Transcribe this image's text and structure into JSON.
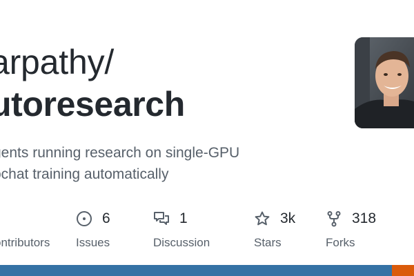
{
  "owner": "arpathy/",
  "repo": "utoresearch",
  "description": [
    "gents running research on single-GPU",
    "ochat training automatically"
  ],
  "stats": {
    "contributors": {
      "value": "",
      "label": "ontributors"
    },
    "issues": {
      "value": "6",
      "label": "Issues",
      "icon": "issue-opened-icon"
    },
    "discussion": {
      "value": "1",
      "label": "Discussion",
      "icon": "comment-discussion-icon"
    },
    "stars": {
      "value": "3k",
      "label": "Stars",
      "icon": "star-icon"
    },
    "forks": {
      "value": "318",
      "label": "Forks",
      "icon": "repo-forked-icon"
    }
  },
  "language_bar": {
    "segments": [
      {
        "color": "#3572A5",
        "share": 0.947
      },
      {
        "color": "#DA5B0B",
        "share": 0.053
      }
    ]
  },
  "colors": {
    "text": "#24292f",
    "muted": "#57606a"
  }
}
